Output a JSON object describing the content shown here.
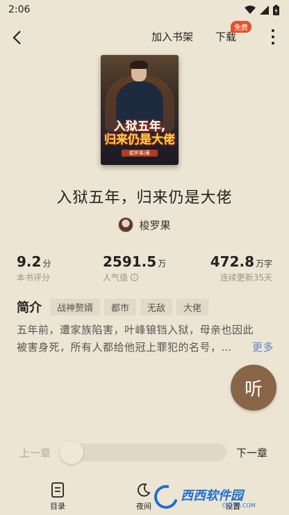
{
  "status_bar": {
    "time": "2:06"
  },
  "top_bar": {
    "add_to_shelf": "加入书架",
    "download": "下载",
    "free_badge": "免费"
  },
  "cover": {
    "title_line1": "入狱五年,",
    "title_line2": "归来仍是大佬",
    "author_tag": "梭罗果|著"
  },
  "book": {
    "title": "入狱五年，归来仍是大佬",
    "author": "梭罗果"
  },
  "stats": {
    "rating": {
      "value": "9.2",
      "unit": "分",
      "label": "本书评分"
    },
    "popularity": {
      "value": "2591.5",
      "unit": "万",
      "label": "人气值"
    },
    "words": {
      "value": "472.8",
      "unit": "万字",
      "label": "连续更新35天"
    }
  },
  "intro": {
    "label": "简介",
    "tags": [
      "战神赘婿",
      "都市",
      "无敌",
      "大佬"
    ],
    "line1": "五年前，遭家族陷害，叶峰锒铛入狱，母亲也因此",
    "line2": "被害身死，所有人都给他冠上罪犯的名号，…",
    "more": "更多"
  },
  "listen": {
    "label": "听"
  },
  "chapter_nav": {
    "prev": "上一章",
    "next": "下一章",
    "progress": 0
  },
  "bottom_nav": {
    "toc": "目录",
    "night": "夜间",
    "settings": "设置"
  },
  "watermark": {
    "brand": "西西软件园",
    "url": "CR173.COM"
  },
  "colors": {
    "background": "#ece5d3",
    "listen_button": "#8a6446",
    "badge": "#e0542d",
    "link": "#5a87c0"
  }
}
